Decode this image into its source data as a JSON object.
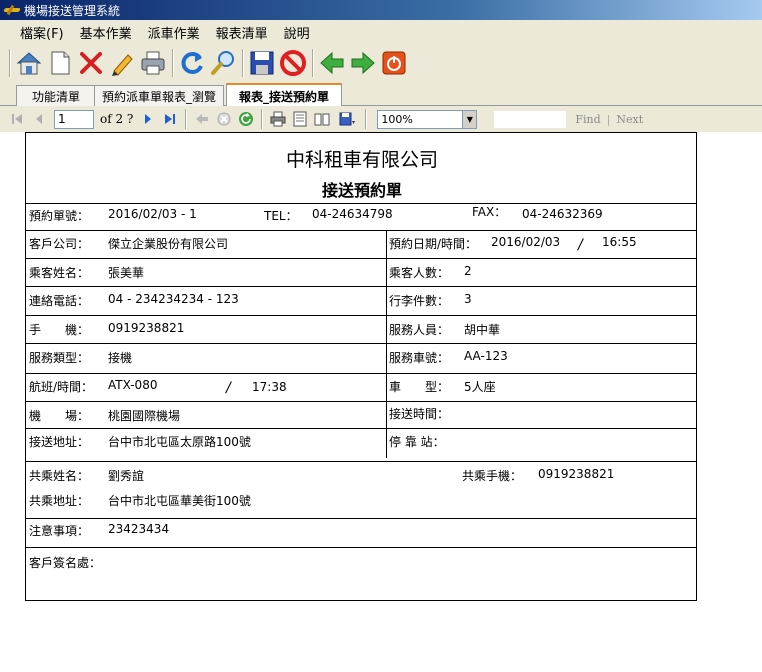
{
  "window": {
    "title": "機場接送管理系統"
  },
  "menu": [
    "檔案(F)",
    "基本作業",
    "派車作業",
    "報表清單",
    "說明"
  ],
  "toolbar_icons": [
    "home-icon",
    "new-document-icon",
    "delete-icon",
    "edit-pencil-icon",
    "print-icon",
    "refresh-icon",
    "search-icon",
    "save-icon",
    "cancel-icon",
    "previous-icon",
    "next-icon",
    "power-icon"
  ],
  "tabs": [
    {
      "label": "功能清單"
    },
    {
      "label": "預約派車單報表_瀏覽"
    },
    {
      "label": "報表_接送預約單",
      "active": true
    }
  ],
  "report_toolbar": {
    "page_value": "1",
    "page_of": "of 2 ?",
    "zoom": "100%",
    "find_label": "Find",
    "separator": "|",
    "next_label": "Next"
  },
  "report": {
    "company": "中科租車有限公司",
    "doc_title": "接送預約單",
    "booking_no_label": "預約單號：",
    "booking_no": "2016/02/03 - 1",
    "tel_label": "TEL：",
    "tel": "04-24634798",
    "fax_label": "FAX：",
    "fax": "04-24632369",
    "customer_label": "客戶公司：",
    "customer": "傑立企業股份有限公司",
    "datetime_label": "預約日期/時間：",
    "date": "2016/02/03",
    "slash": "/",
    "time": "16:55",
    "passenger_label": "乘客姓名：",
    "passenger": "張美華",
    "pax_label": "乘客人數：",
    "pax": "2",
    "phone_label": "連絡電話：",
    "phone": "04 - 234234234 - 123",
    "luggage_label": "行李件數：",
    "luggage": "3",
    "mobile_label": "手　　機：",
    "mobile": "0919238821",
    "staff_label": "服務人員：",
    "staff": "胡中華",
    "service_type_label": "服務類型：",
    "service_type": "接機",
    "car_no_label": "服務車號：",
    "car_no": "AA-123",
    "flight_label": "航班/時間：",
    "flight": "ATX-080",
    "flight_time": "17:38",
    "car_type_label": "車　　型：",
    "car_type": "5人座",
    "airport_label": "機　　場：",
    "airport": "桃園國際機場",
    "pickup_time_label": "接送時間：",
    "address_label": "接送地址：",
    "address": "台中市北屯區太原路100號",
    "stop_label": "停 靠 站：",
    "co_name_label": "共乘姓名：",
    "co_name": "劉秀誼",
    "co_mobile_label": "共乘手機：",
    "co_mobile": "0919238821",
    "co_address_label": "共乘地址：",
    "co_address": "台中市北屯區華美街100號",
    "notes_label": "注意事項：",
    "notes": "23423434",
    "signature_label": "客戶簽名處："
  }
}
